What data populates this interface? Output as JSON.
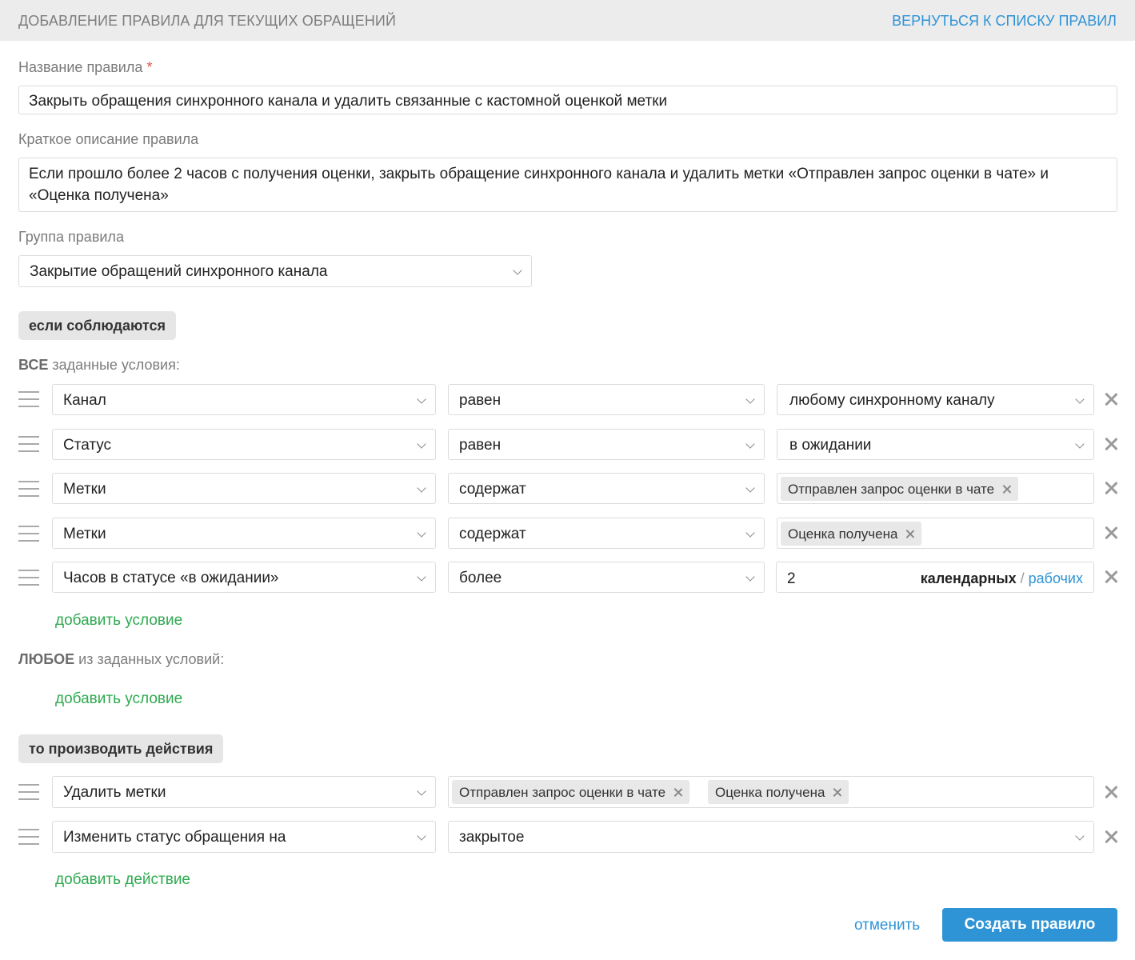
{
  "header": {
    "title": "ДОБАВЛЕНИЕ ПРАВИЛА ДЛЯ ТЕКУЩИХ ОБРАЩЕНИЙ",
    "back_link": "ВЕРНУТЬСЯ К СПИСКУ ПРАВИЛ"
  },
  "form": {
    "name_label": "Название правила",
    "name_required_mark": "*",
    "name_value": "Закрыть обращения синхронного канала и удалить связанные с кастомной оценкой метки",
    "description_label": "Краткое описание правила",
    "description_value": "Если прошло более 2 часов с получения оценки, закрыть обращение синхронного канала и удалить метки «Отправлен запрос оценки в чате» и «Оценка получена»",
    "group_label": "Группа правила",
    "group_value": "Закрытие обращений синхронного канала"
  },
  "conditions": {
    "section_pill": "если соблюдаются",
    "all_caption_bold": "ВСЕ",
    "all_caption_rest": " заданные условия:",
    "rows": [
      {
        "field": "Канал",
        "operator": "равен",
        "value": "любому синхронному каналу"
      },
      {
        "field": "Статус",
        "operator": "равен",
        "value": "в ожидании"
      },
      {
        "field": "Метки",
        "operator": "содержат",
        "tags": [
          "Отправлен запрос оценки в чате"
        ]
      },
      {
        "field": "Метки",
        "operator": "содержат",
        "tags": [
          "Оценка получена"
        ]
      },
      {
        "field": "Часов в статусе «в ожидании»",
        "operator": "более",
        "hours": "2",
        "mode_active": "календарных",
        "mode_sep": " / ",
        "mode_alt": "рабочих"
      }
    ],
    "add_condition_all": "добавить условие",
    "any_caption_bold": "ЛЮБОЕ",
    "any_caption_rest": " из заданных условий:",
    "add_condition_any": "добавить условие"
  },
  "actions": {
    "section_pill": "то производить действия",
    "rows": [
      {
        "action": "Удалить метки",
        "tags": [
          "Отправлен запрос оценки в чате",
          "Оценка получена"
        ]
      },
      {
        "action": "Изменить статус обращения на",
        "value": "закрытое"
      }
    ],
    "add_action": "добавить действие"
  },
  "footer": {
    "cancel": "отменить",
    "submit": "Создать правило"
  },
  "icons": [
    "drag-handle-icon",
    "chevron-down-icon",
    "close-icon"
  ],
  "colors": {
    "accent_blue": "#2f94d6",
    "add_green": "#2eaa4f",
    "required_red": "#e0534e",
    "header_bg": "#ececec"
  }
}
